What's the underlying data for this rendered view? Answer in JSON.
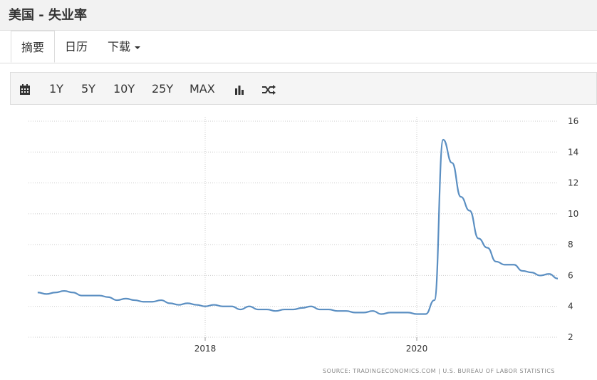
{
  "page": {
    "title": "美国 - 失业率"
  },
  "tabs": [
    {
      "label": "摘要",
      "active": true
    },
    {
      "label": "日历",
      "active": false
    },
    {
      "label": "下载",
      "active": false,
      "dropdown": true
    }
  ],
  "toolbar": {
    "calendar_icon": "calendar-icon",
    "ranges": [
      "1Y",
      "5Y",
      "10Y",
      "25Y",
      "MAX"
    ],
    "bar_chart_icon": "bar-chart-icon",
    "shuffle_icon": "shuffle-icon"
  },
  "chart_data": {
    "type": "line",
    "title": "",
    "xlabel": "",
    "ylabel": "",
    "ylim": [
      2,
      16
    ],
    "y_ticks": [
      "2",
      "4",
      "6",
      "8",
      "10",
      "12",
      "14",
      "16"
    ],
    "x_ticks": [
      "2018",
      "2020"
    ],
    "grid": true,
    "line_color": "#5b8fc2",
    "series": [
      {
        "name": "",
        "x": [
          "2016-06",
          "2016-07",
          "2016-08",
          "2016-09",
          "2016-10",
          "2016-11",
          "2016-12",
          "2017-01",
          "2017-02",
          "2017-03",
          "2017-04",
          "2017-05",
          "2017-06",
          "2017-07",
          "2017-08",
          "2017-09",
          "2017-10",
          "2017-11",
          "2017-12",
          "2018-01",
          "2018-02",
          "2018-03",
          "2018-04",
          "2018-05",
          "2018-06",
          "2018-07",
          "2018-08",
          "2018-09",
          "2018-10",
          "2018-11",
          "2018-12",
          "2019-01",
          "2019-02",
          "2019-03",
          "2019-04",
          "2019-05",
          "2019-06",
          "2019-07",
          "2019-08",
          "2019-09",
          "2019-10",
          "2019-11",
          "2019-12",
          "2020-01",
          "2020-02",
          "2020-03",
          "2020-04",
          "2020-05",
          "2020-06",
          "2020-07",
          "2020-08",
          "2020-09",
          "2020-10",
          "2020-11",
          "2020-12",
          "2021-01",
          "2021-02",
          "2021-03",
          "2021-04"
        ],
        "values": [
          4.9,
          4.8,
          4.9,
          5.0,
          4.9,
          4.7,
          4.7,
          4.7,
          4.6,
          4.4,
          4.5,
          4.4,
          4.3,
          4.3,
          4.4,
          4.2,
          4.1,
          4.2,
          4.1,
          4.0,
          4.1,
          4.0,
          4.0,
          3.8,
          4.0,
          3.8,
          3.8,
          3.7,
          3.8,
          3.8,
          3.9,
          4.0,
          3.8,
          3.8,
          3.7,
          3.7,
          3.6,
          3.6,
          3.7,
          3.5,
          3.6,
          3.6,
          3.6,
          3.5,
          3.5,
          4.4,
          14.8,
          13.3,
          11.1,
          10.2,
          8.4,
          7.8,
          6.9,
          6.7,
          6.7,
          6.3,
          6.2,
          6.0,
          6.1
        ]
      },
      {
        "name": "",
        "x": [
          "2021-05"
        ],
        "values": [
          5.8
        ]
      }
    ]
  },
  "source": {
    "text": "SOURCE: TRADINGECONOMICS.COM | U.S. BUREAU OF LABOR STATISTICS"
  }
}
